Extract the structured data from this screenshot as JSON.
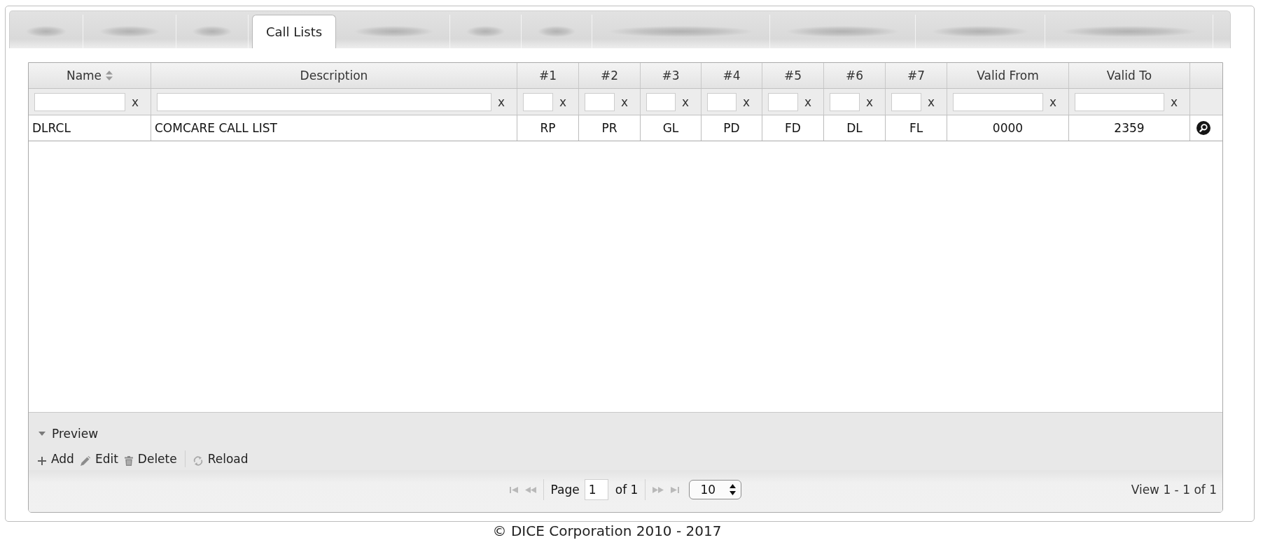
{
  "tabs": [
    {
      "kind": "blurred",
      "selected": false
    },
    {
      "kind": "blurred",
      "selected": false
    },
    {
      "kind": "blurred",
      "selected": false
    },
    {
      "kind": "text",
      "label": "Call Lists",
      "selected": true
    },
    {
      "kind": "blurred",
      "selected": false
    },
    {
      "kind": "blurred",
      "selected": false
    },
    {
      "kind": "blurred",
      "selected": false
    },
    {
      "kind": "blurred",
      "selected": false
    },
    {
      "kind": "blurred",
      "selected": false
    },
    {
      "kind": "blurred",
      "selected": false
    },
    {
      "kind": "blurred",
      "selected": false
    }
  ],
  "grid": {
    "columns": [
      {
        "label": "Name",
        "sortable": true,
        "filter_clear": "x"
      },
      {
        "label": "Description",
        "filter_clear": "x"
      },
      {
        "label": "#1",
        "filter_clear": "x"
      },
      {
        "label": "#2",
        "filter_clear": "x"
      },
      {
        "label": "#3",
        "filter_clear": "x"
      },
      {
        "label": "#4",
        "filter_clear": "x"
      },
      {
        "label": "#5",
        "filter_clear": "x"
      },
      {
        "label": "#6",
        "filter_clear": "x"
      },
      {
        "label": "#7",
        "filter_clear": "x"
      },
      {
        "label": "Valid From",
        "filter_clear": "x"
      },
      {
        "label": "Valid To",
        "filter_clear": "x"
      },
      {}
    ],
    "rows": [
      {
        "cells": [
          "DLRCL",
          "COMCARE CALL LIST",
          "RP",
          "PR",
          "GL",
          "PD",
          "FD",
          "DL",
          "FL",
          "0000",
          "2359"
        ]
      }
    ]
  },
  "preview": {
    "label": "Preview",
    "expanded": true
  },
  "toolbar": [
    {
      "kind": "add",
      "label": "Add"
    },
    {
      "kind": "edit",
      "label": "Edit"
    },
    {
      "kind": "delete",
      "label": "Delete"
    },
    {
      "kind": "reload",
      "label": "Reload"
    }
  ],
  "pager": {
    "page_label": "Page",
    "page": "1",
    "total": "of 1",
    "page_size": "10",
    "summary": "View 1 - 1 of 1"
  },
  "footer": "© DICE Corporation 2010 - 2017"
}
